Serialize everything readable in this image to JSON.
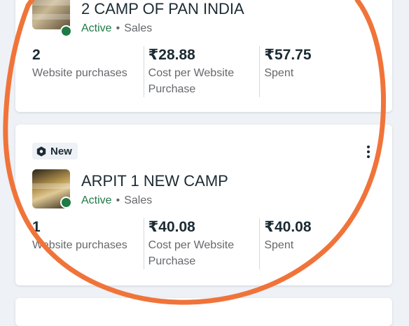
{
  "campaigns": [
    {
      "name": "2 CAMP OF PAN INDIA",
      "status": "Active",
      "separator": "•",
      "objective": "Sales",
      "metrics": [
        {
          "value": "2",
          "label": "Website purchases"
        },
        {
          "value": "₹28.88",
          "label": "Cost per Website Purchase"
        },
        {
          "value": "₹57.75",
          "label": "Spent"
        }
      ]
    },
    {
      "badge": "New",
      "name": "ARPIT 1 NEW CAMP",
      "status": "Active",
      "separator": "•",
      "objective": "Sales",
      "metrics": [
        {
          "value": "1",
          "label": "Website purchases"
        },
        {
          "value": "₹40.08",
          "label": "Cost per Website Purchase"
        },
        {
          "value": "₹40.08",
          "label": "Spent"
        }
      ]
    }
  ],
  "colors": {
    "active": "#1f7a45",
    "annotation": "#f0743a",
    "muted_text": "#65676b",
    "primary_text": "#1c2b33"
  },
  "icons": [
    "badge-hexagon-icon",
    "more-options-icon",
    "status-dot-icon"
  ]
}
